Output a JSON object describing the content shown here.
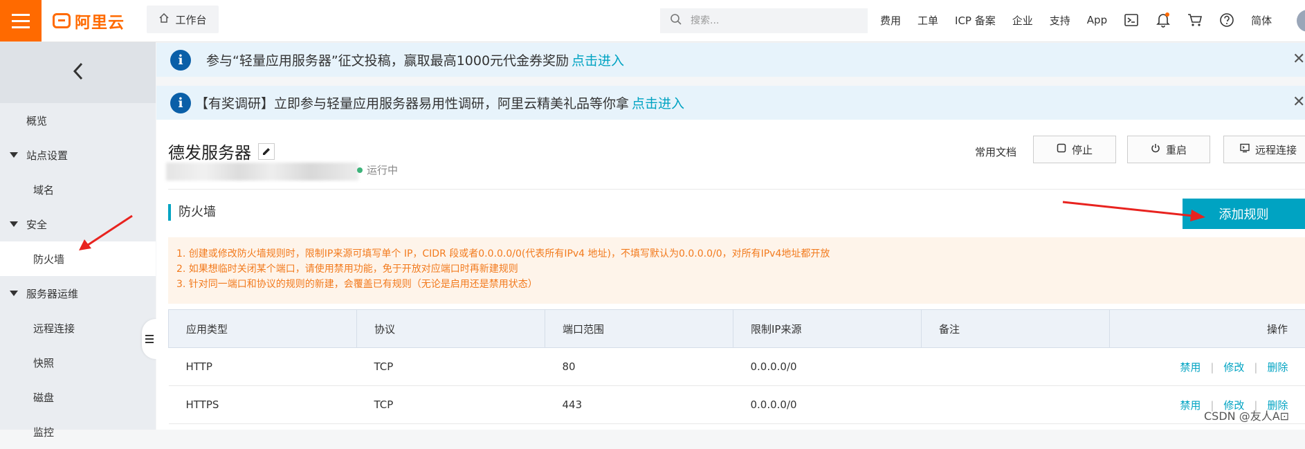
{
  "brand": {
    "logo_text": "阿里云",
    "accent": "#ff6a00"
  },
  "topbar": {
    "workbench": "工作台",
    "search_placeholder": "搜索...",
    "nav": [
      "费用",
      "工单",
      "ICP 备案",
      "企业",
      "支持",
      "App"
    ],
    "lang": "简体",
    "icons": [
      "terminal-icon",
      "bell-icon",
      "cart-icon",
      "help-icon"
    ]
  },
  "sidebar": {
    "items": [
      {
        "label": "概览"
      },
      {
        "label": "站点设置"
      },
      {
        "label": "域名"
      },
      {
        "label": "安全"
      },
      {
        "label": "防火墙"
      },
      {
        "label": "服务器运维"
      },
      {
        "label": "远程连接"
      },
      {
        "label": "快照"
      },
      {
        "label": "磁盘"
      },
      {
        "label": "监控"
      }
    ]
  },
  "notices": [
    {
      "text": "参与“轻量应用服务器”征文投稿，赢取最高1000元代金券奖励",
      "link": "点击进入"
    },
    {
      "text": "【有奖调研】立即参与轻量应用服务器易用性调研，阿里云精美礼品等你拿",
      "link": "点击进入"
    }
  ],
  "server": {
    "name": "德发服务器",
    "status": "运行中",
    "docs": "常用文档",
    "actions": {
      "stop": "停止",
      "restart": "重启",
      "remote": "远程连接"
    }
  },
  "firewall": {
    "title": "防火墙",
    "add_button": "添加规则",
    "tips": [
      "1. 创建或修改防火墙规则时，限制IP来源可填写单个 IP，CIDR 段或者0.0.0.0/0(代表所有IPv4 地址)，不填写默认为0.0.0.0/0，对所有IPv4地址都开放",
      "2. 如果想临时关闭某个端口，请使用禁用功能，免于开放对应端口时再新建规则",
      "3. 针对同一端口和协议的规则的新建，会覆盖已有规则（无论是启用还是禁用状态）"
    ],
    "table": {
      "headers": [
        "应用类型",
        "协议",
        "端口范围",
        "限制IP来源",
        "备注",
        "操作"
      ],
      "rows": [
        {
          "app": "HTTP",
          "protocol": "TCP",
          "port": "80",
          "source": "0.0.0.0/0",
          "note": ""
        },
        {
          "app": "HTTPS",
          "protocol": "TCP",
          "port": "443",
          "source": "0.0.0.0/0",
          "note": ""
        }
      ],
      "row_actions": {
        "disable": "禁用",
        "edit": "修改",
        "delete": "删除"
      }
    }
  },
  "watermark": "CSDN @友人A⊡"
}
